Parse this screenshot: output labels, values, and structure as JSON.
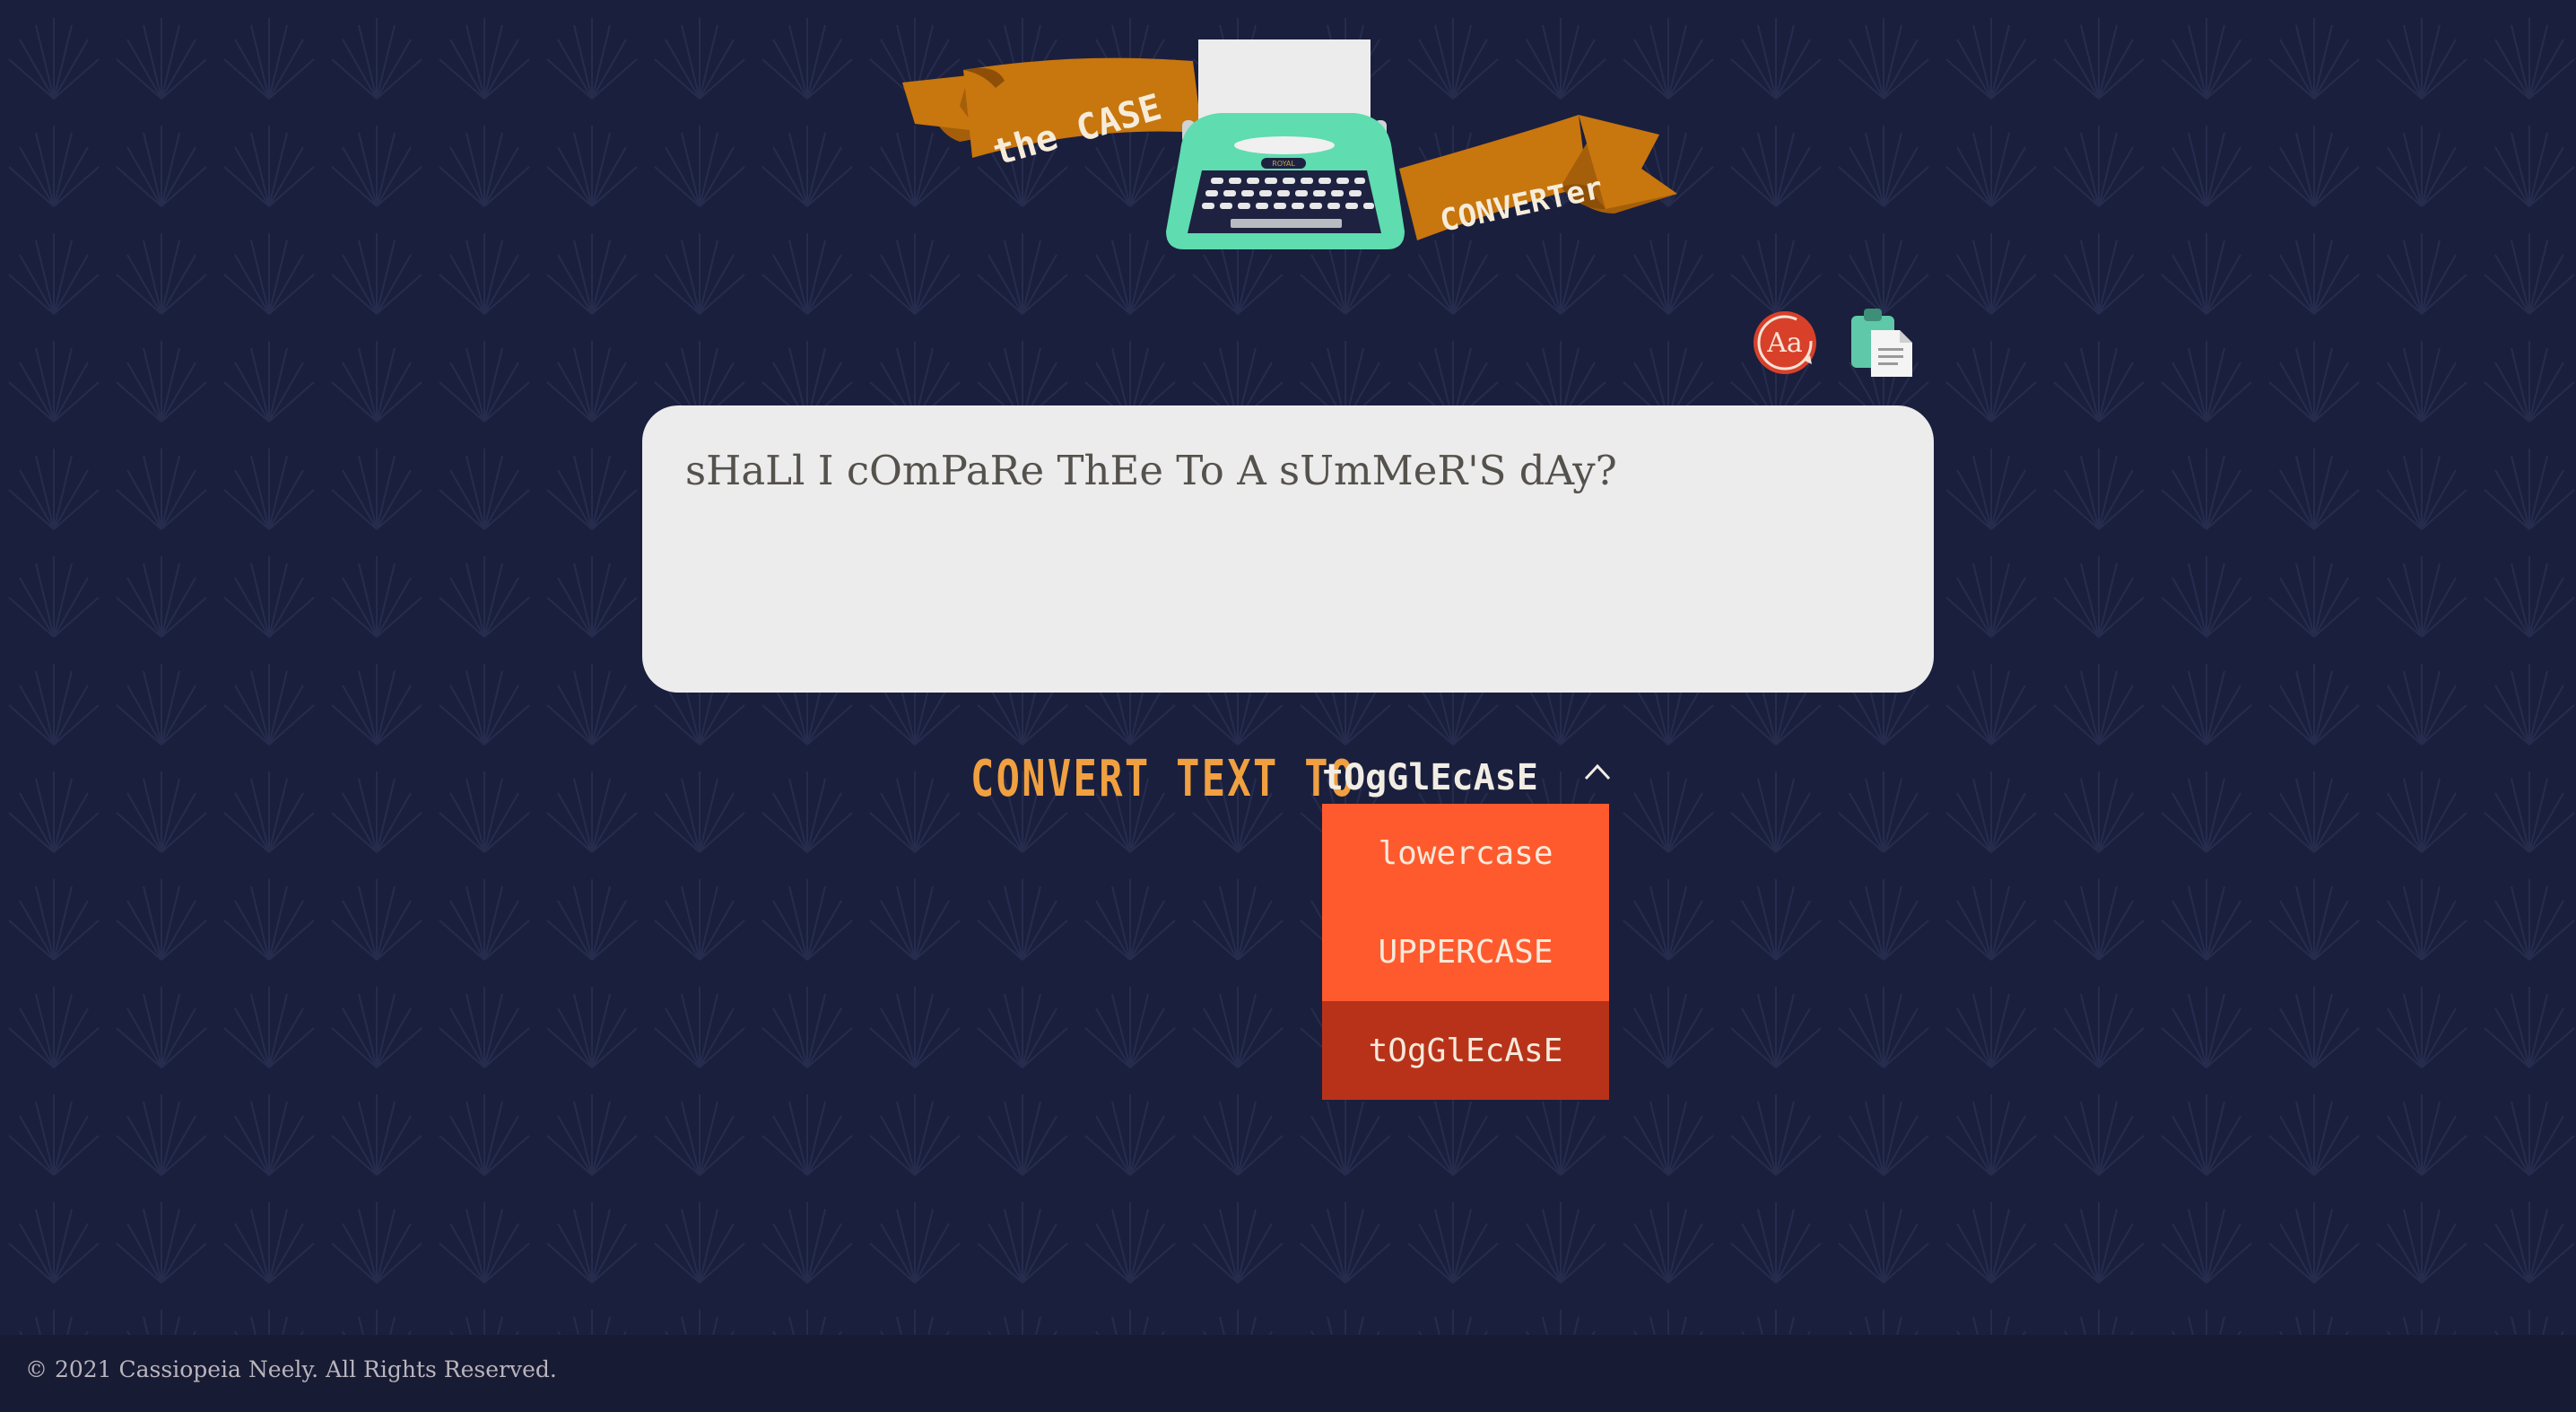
{
  "app": {
    "logo_text_left": "the CASE",
    "logo_text_right": "CONVERTer",
    "typewriter_brand": "ROYAL"
  },
  "toolbar": {
    "case_toggle_icon": "Aa",
    "copy_icon": "clipboard-icon"
  },
  "editor": {
    "text": "sHaLl I cOmPaRe ThEe To A sUmMeR'S dAy?"
  },
  "convert": {
    "label": "CONVERT TEXT TO",
    "current_mode": "tOgGlEcAsE",
    "options": [
      {
        "label": "lowercase",
        "selected": false
      },
      {
        "label": "UPPERCASE",
        "selected": false
      },
      {
        "label": "tOgGlEcAsE",
        "selected": true
      }
    ]
  },
  "footer": {
    "copyright": "© 2021 Cassiopeia Neely. All Rights Reserved."
  },
  "colors": {
    "background": "#1a1f3d",
    "banner": "#c8760e",
    "typewriter": "#5fdcb0",
    "accent_orange": "#f0a040",
    "dropdown": "#ff5a2e",
    "dropdown_selected": "#b8321a",
    "icon_red": "#d8402a"
  }
}
